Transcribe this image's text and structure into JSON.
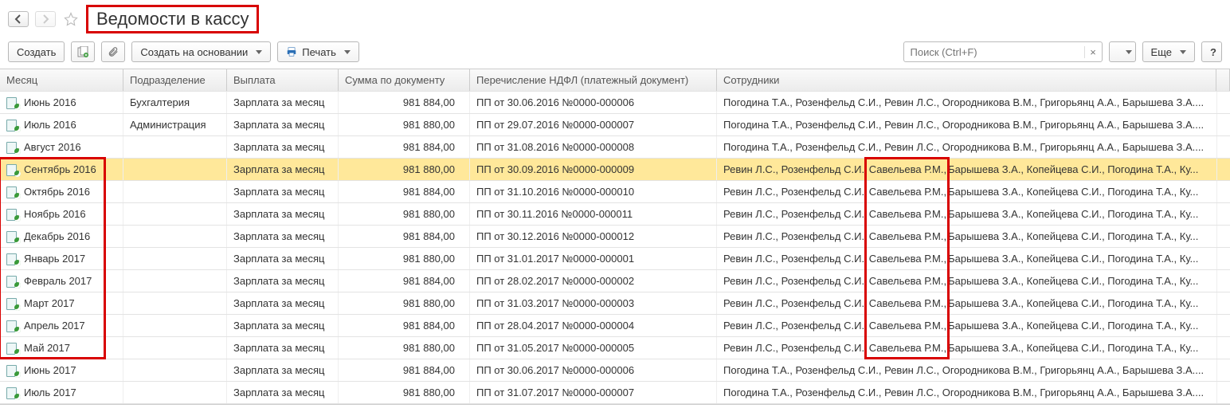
{
  "title": "Ведомости в кассу",
  "toolbar": {
    "create_label": "Создать",
    "create_based_label": "Создать на основании",
    "print_label": "Печать",
    "more_label": "Еще"
  },
  "search": {
    "placeholder": "Поиск (Ctrl+F)"
  },
  "columns": {
    "month": "Месяц",
    "dept": "Подразделение",
    "payout": "Выплата",
    "sum": "Сумма по документу",
    "ndfl": "Перечисление НДФЛ (платежный документ)",
    "employees": "Сотрудники"
  },
  "selected_index": 3,
  "highlight_months_from_index": 3,
  "highlight_months_to_index": 11,
  "highlight_emp_mid_from_index": 3,
  "highlight_emp_mid_to_index": 11,
  "emp_set_a": {
    "full": "Погодина Т.А., Розенфельд С.И., Ревин Л.С., Огородникова В.М., Григорьянц А.А., Барышева З.А...."
  },
  "emp_set_b": {
    "left": "Ревин Л.С., Розенфельд С.И.,",
    "mid": "Савельева Р.М.,",
    "right": "Барышева З.А., Копейцева С.И., Погодина Т.А., Ку..."
  },
  "rows": [
    {
      "month": "Июнь 2016",
      "dept": "Бухгалтерия",
      "payout": "Зарплата за месяц",
      "sum": "981 884,00",
      "ndfl": "ПП от 30.06.2016 №0000-000006",
      "emp": "a"
    },
    {
      "month": "Июль 2016",
      "dept": "Администрация",
      "payout": "Зарплата за месяц",
      "sum": "981 880,00",
      "ndfl": "ПП от 29.07.2016 №0000-000007",
      "emp": "a"
    },
    {
      "month": "Август 2016",
      "dept": "",
      "payout": "Зарплата за месяц",
      "sum": "981 884,00",
      "ndfl": "ПП от 31.08.2016 №0000-000008",
      "emp": "a"
    },
    {
      "month": "Сентябрь 2016",
      "dept": "",
      "payout": "Зарплата за месяц",
      "sum": "981 880,00",
      "ndfl": "ПП от 30.09.2016 №0000-000009",
      "emp": "b"
    },
    {
      "month": "Октябрь 2016",
      "dept": "",
      "payout": "Зарплата за месяц",
      "sum": "981 884,00",
      "ndfl": "ПП от 31.10.2016 №0000-000010",
      "emp": "b"
    },
    {
      "month": "Ноябрь 2016",
      "dept": "",
      "payout": "Зарплата за месяц",
      "sum": "981 880,00",
      "ndfl": "ПП от 30.11.2016 №0000-000011",
      "emp": "b"
    },
    {
      "month": "Декабрь 2016",
      "dept": "",
      "payout": "Зарплата за месяц",
      "sum": "981 884,00",
      "ndfl": "ПП от 30.12.2016 №0000-000012",
      "emp": "b"
    },
    {
      "month": "Январь 2017",
      "dept": "",
      "payout": "Зарплата за месяц",
      "sum": "981 880,00",
      "ndfl": "ПП от 31.01.2017 №0000-000001",
      "emp": "b"
    },
    {
      "month": "Февраль 2017",
      "dept": "",
      "payout": "Зарплата за месяц",
      "sum": "981 884,00",
      "ndfl": "ПП от 28.02.2017 №0000-000002",
      "emp": "b"
    },
    {
      "month": "Март 2017",
      "dept": "",
      "payout": "Зарплата за месяц",
      "sum": "981 880,00",
      "ndfl": "ПП от 31.03.2017 №0000-000003",
      "emp": "b"
    },
    {
      "month": "Апрель 2017",
      "dept": "",
      "payout": "Зарплата за месяц",
      "sum": "981 884,00",
      "ndfl": "ПП от 28.04.2017 №0000-000004",
      "emp": "b"
    },
    {
      "month": "Май 2017",
      "dept": "",
      "payout": "Зарплата за месяц",
      "sum": "981 880,00",
      "ndfl": "ПП от 31.05.2017 №0000-000005",
      "emp": "b"
    },
    {
      "month": "Июнь 2017",
      "dept": "",
      "payout": "Зарплата за месяц",
      "sum": "981 884,00",
      "ndfl": "ПП от 30.06.2017 №0000-000006",
      "emp": "a"
    },
    {
      "month": "Июль 2017",
      "dept": "",
      "payout": "Зарплата за месяц",
      "sum": "981 880,00",
      "ndfl": "ПП от 31.07.2017 №0000-000007",
      "emp": "a"
    }
  ]
}
